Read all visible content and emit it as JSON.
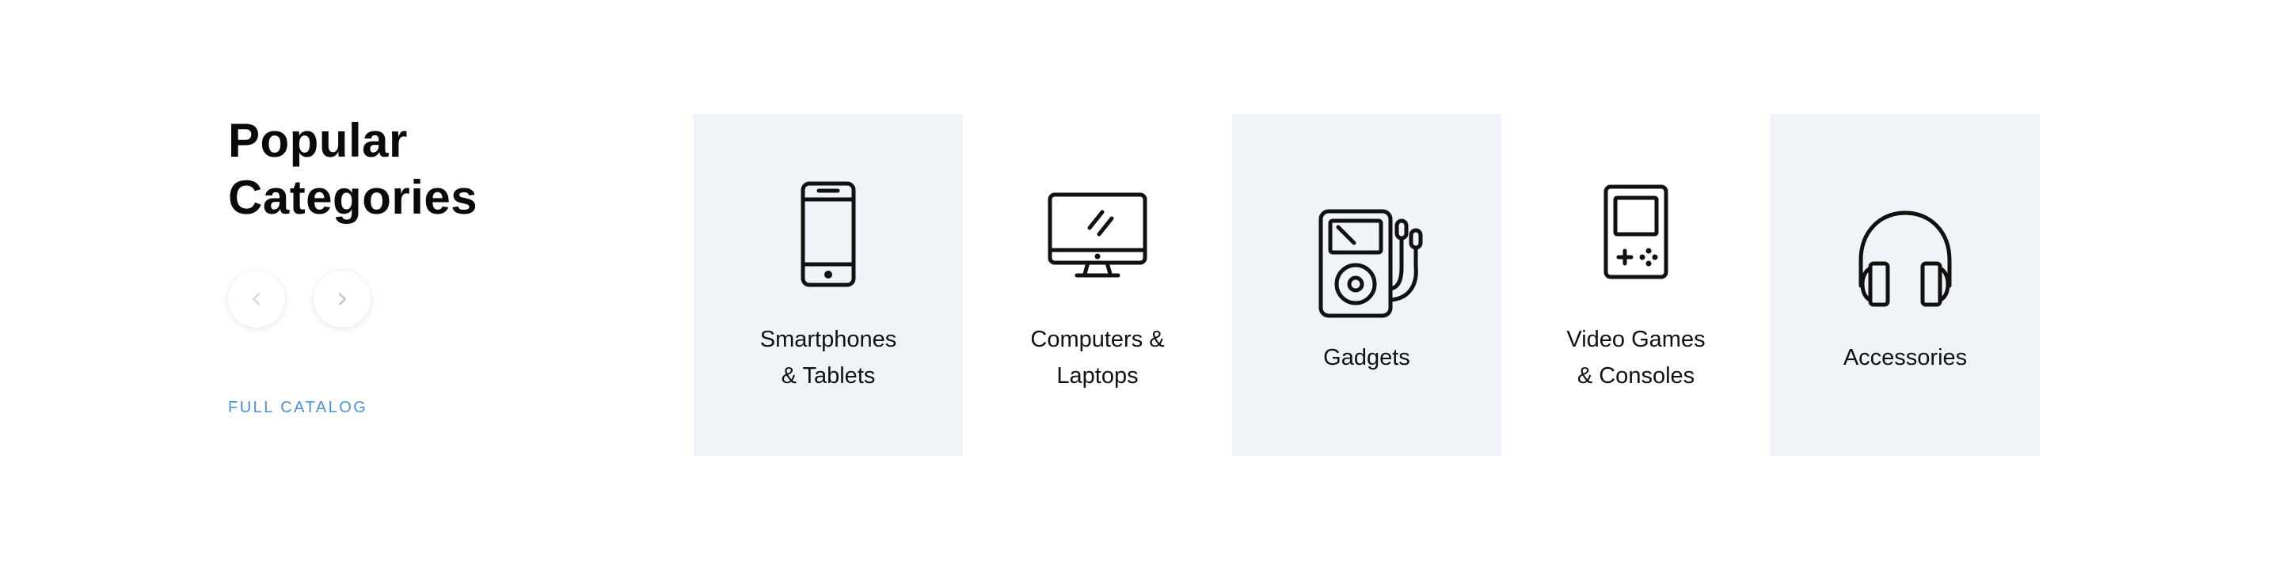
{
  "section": {
    "title": "Popular\nCategories",
    "full_catalog_label": "FULL CATALOG"
  },
  "navigation": {
    "prev_icon": "chevron-left-icon",
    "next_icon": "chevron-right-icon"
  },
  "colors": {
    "shaded_tile": "#f0f4f8",
    "link": "#4a90d9",
    "icon_stroke": "#111111"
  },
  "categories": [
    {
      "label": "Smartphones\n& Tablets",
      "icon": "smartphone-icon"
    },
    {
      "label": "Computers &\nLaptops",
      "icon": "desktop-computer-icon"
    },
    {
      "label": "Gadgets",
      "icon": "music-player-icon"
    },
    {
      "label": "Video Games\n& Consoles",
      "icon": "handheld-console-icon"
    },
    {
      "label": "Accessories",
      "icon": "headphones-icon"
    }
  ]
}
